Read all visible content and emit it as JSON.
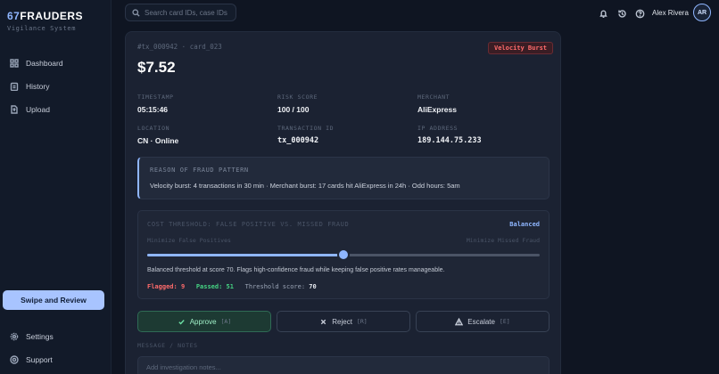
{
  "app": {
    "logo_num": "67",
    "logo_name": "FRAUDERS",
    "tagline": "Vigilance System"
  },
  "sidebar": {
    "items": [
      {
        "label": "Dashboard",
        "icon": "grid-icon"
      },
      {
        "label": "History",
        "icon": "clipboard-icon"
      },
      {
        "label": "Upload",
        "icon": "upload-icon"
      }
    ],
    "cta": "Swipe and Review",
    "bottom": [
      {
        "label": "Settings",
        "icon": "gear-icon"
      },
      {
        "label": "Support",
        "icon": "help-icon"
      }
    ]
  },
  "header": {
    "search_placeholder": "Search card IDs, case IDs",
    "user_name": "Alex Rivera",
    "avatar_initials": "AR"
  },
  "case": {
    "meta": "#tx_000942 · card_023",
    "badge": "Velocity Burst",
    "amount": "$7.52",
    "fields": [
      {
        "label": "TIMESTAMP",
        "value": "05:15:46"
      },
      {
        "label": "RISK SCORE",
        "value": "100 / 100"
      },
      {
        "label": "MERCHANT",
        "value": "AliExpress"
      },
      {
        "label": "LOCATION",
        "value": "CN · Online"
      },
      {
        "label": "TRANSACTION ID",
        "value": "tx_000942"
      },
      {
        "label": "IP ADDRESS",
        "value": "189.144.75.233"
      }
    ],
    "reason_title": "REASON OF FRAUD PATTERN",
    "reason_text": "Velocity burst: 4 transactions in 30 min · Merchant burst: 17 cards hit AliExpress in 24h · Odd hours: 5am"
  },
  "threshold": {
    "title": "COST THRESHOLD: FALSE POSITIVE VS. MISSED FRAUD",
    "mode": "Balanced",
    "left_label": "Minimize False Positives",
    "right_label": "Minimize Missed Fraud",
    "slider_value": 0.5,
    "description": "Balanced threshold at score 70. Flags high-confidence fraud while keeping false positive rates manageable.",
    "flagged_label": "Flagged:",
    "flagged": "9",
    "passed_label": "Passed:",
    "passed": "51",
    "score_label": "Threshold score:",
    "score": "70"
  },
  "actions": {
    "approve": "Approve",
    "approve_key": "[A]",
    "reject": "Reject",
    "reject_key": "[R]",
    "escalate": "Escalate",
    "escalate_key": "[E]"
  },
  "notes": {
    "label": "MESSAGE / NOTES",
    "placeholder": "Add investigation notes..."
  },
  "colors": {
    "accent": "#8fb6ff",
    "danger": "#ff6b6b",
    "success": "#45d483"
  }
}
